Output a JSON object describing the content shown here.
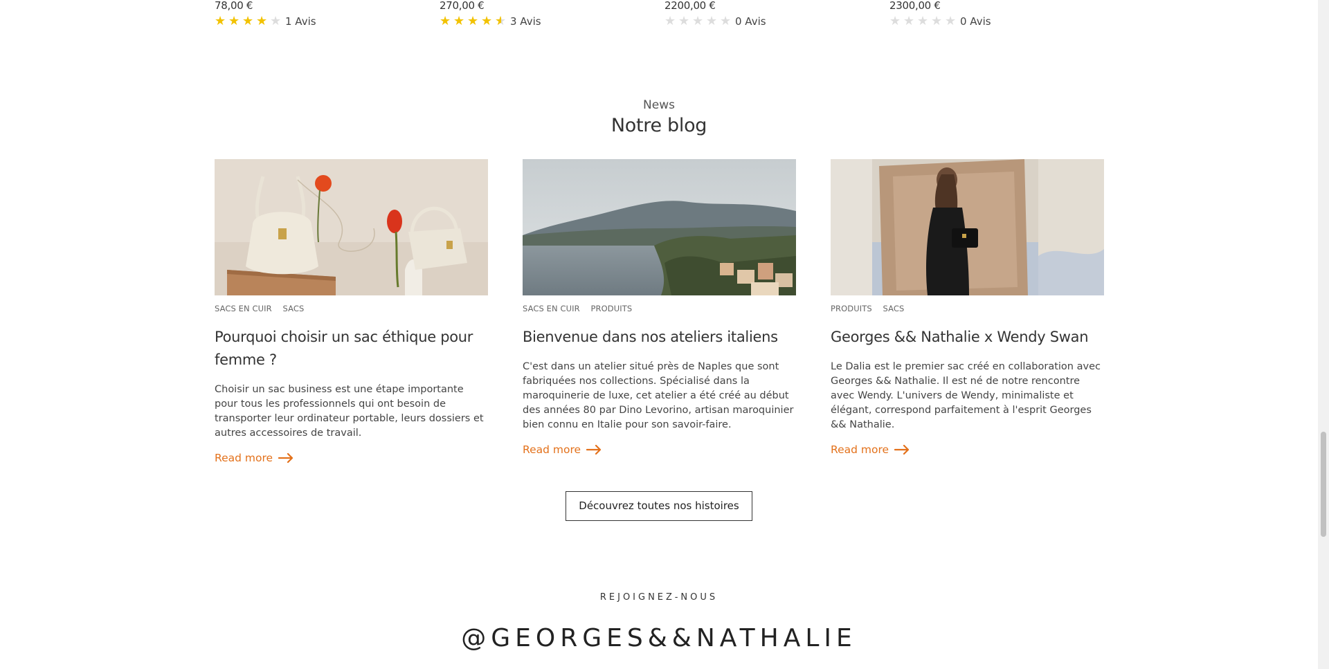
{
  "products": [
    {
      "price": "78,00 €",
      "rating": 4,
      "reviews": "1 Avis"
    },
    {
      "price": "270,00 €",
      "rating": 4.5,
      "reviews": "3 Avis"
    },
    {
      "price": "2200,00 €",
      "rating": 0,
      "reviews": "0 Avis"
    },
    {
      "price": "2300,00 €",
      "rating": 0,
      "reviews": "0 Avis"
    }
  ],
  "section": {
    "label": "News",
    "title": "Notre blog"
  },
  "posts": [
    {
      "tags": [
        "SACS EN CUIR",
        "SACS"
      ],
      "title": "Pourquoi choisir un sac éthique pour femme ?",
      "excerpt": "Choisir un sac business est une étape importante pour tous les professionnels qui ont besoin de transporter leur ordinateur portable, leurs dossiers et autres accessoires de travail.",
      "read_more": "Read more",
      "image": "bags-and-tulips"
    },
    {
      "tags": [
        "SACS EN CUIR",
        "PRODUITS"
      ],
      "title": "Bienvenue dans nos ateliers italiens",
      "excerpt": "C'est dans un atelier situé près de  Naples que sont fabriquées nos collections. Spécialisé dans la maroquinerie de luxe, cet atelier a été créé au début des années 80 par  Dino  Levorino, artisan maroquinier bien connu en  Italie pour son savoir-faire.",
      "read_more": "Read more",
      "image": "coastline"
    },
    {
      "tags": [
        "PRODUITS",
        "SACS"
      ],
      "title": "Georges && Nathalie x Wendy Swan",
      "excerpt": "Le  Dalia est le premier sac créé en collaboration avec Georges &&  Nathalie.  Il est né de notre rencontre avec Wendy.  L'univers de Wendy, minimaliste et élégant, correspond parfaitement à l'esprit Georges &&  Nathalie.",
      "read_more": "Read more",
      "image": "woman-with-bag"
    }
  ],
  "cta": {
    "label": "Découvrez toutes nos histoires"
  },
  "join": {
    "label": "REJOIGNEZ-NOUS",
    "handle": "@GEORGES&&NATHALIE"
  },
  "colors": {
    "accent": "#e3711b",
    "star": "#f2c200",
    "star_empty": "#dddddd"
  }
}
